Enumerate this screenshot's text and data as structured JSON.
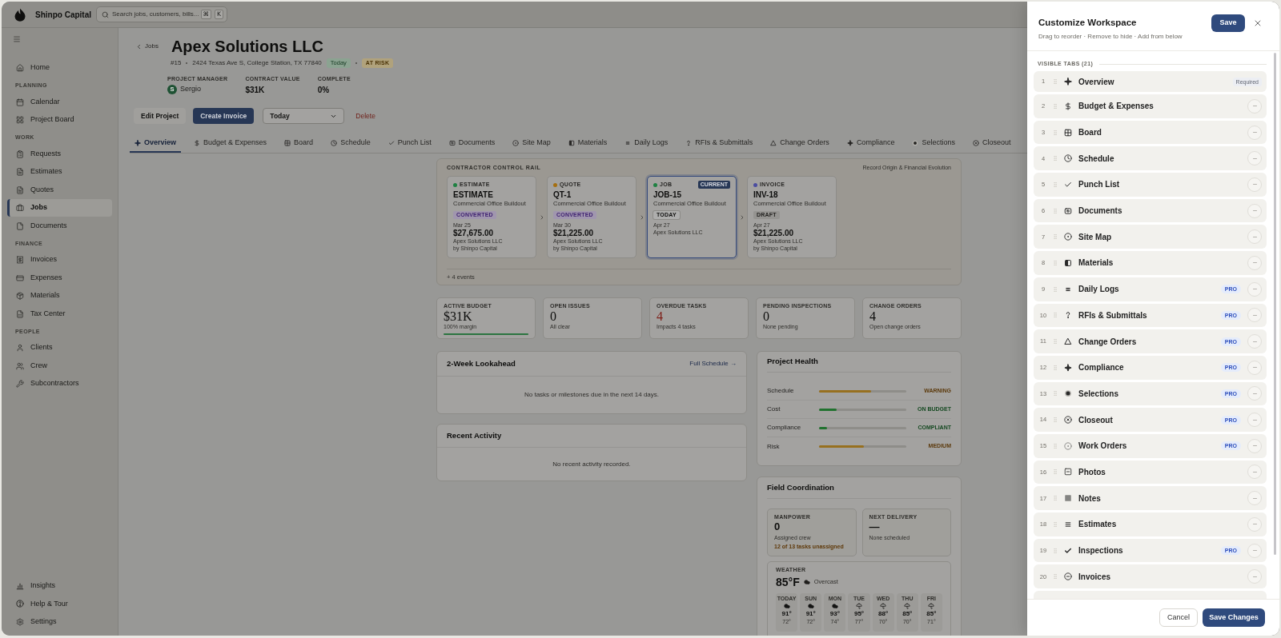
{
  "app": {
    "name": "Shinpo Capital",
    "search": {
      "placeholder": "Search jobs, customers, bills..."
    },
    "shortcut": [
      "⌘",
      "K"
    ]
  },
  "sidebar": {
    "sections": [
      {
        "items": [
          {
            "label": "Home",
            "selected": false
          }
        ]
      },
      {
        "label": "PLANNING",
        "items": [
          {
            "label": "Calendar",
            "selected": false
          },
          {
            "label": "Project Board",
            "selected": false
          }
        ]
      },
      {
        "label": "WORK",
        "items": [
          {
            "label": "Requests",
            "selected": false
          },
          {
            "label": "Estimates",
            "selected": false
          },
          {
            "label": "Quotes",
            "selected": false
          },
          {
            "label": "Jobs",
            "selected": true
          },
          {
            "label": "Documents",
            "selected": false
          }
        ]
      },
      {
        "label": "FINANCE",
        "items": [
          {
            "label": "Invoices",
            "selected": false
          },
          {
            "label": "Expenses",
            "selected": false
          },
          {
            "label": "Materials",
            "selected": false
          },
          {
            "label": "Tax Center",
            "selected": false
          }
        ]
      },
      {
        "label": "PEOPLE",
        "items": [
          {
            "label": "Clients",
            "selected": false
          },
          {
            "label": "Crew",
            "selected": false
          },
          {
            "label": "Subcontractors",
            "selected": false
          }
        ]
      }
    ],
    "footer_items": [
      {
        "label": "Insights",
        "selected": false
      },
      {
        "label": "Help & Tour",
        "selected": false
      },
      {
        "label": "Settings",
        "selected": false
      }
    ]
  },
  "job": {
    "back": "Jobs",
    "title": "Apex Solutions LLC",
    "number": "#15",
    "address": "2424 Texas Ave S, College Station, TX 77840",
    "badges": [
      {
        "text": "Today",
        "kind": "success"
      },
      {
        "text": "AT RISK",
        "kind": "warning"
      }
    ],
    "meta": [
      {
        "label": "PROJECT MANAGER",
        "value": "Sergio",
        "avatar": "S"
      },
      {
        "label": "CONTRACT VALUE",
        "value": "$31K"
      },
      {
        "label": "COMPLETE",
        "value": "0%"
      }
    ]
  },
  "actions": {
    "buttons": [
      {
        "label": "Edit Project",
        "kind": "secondary"
      },
      {
        "label": "Create Invoice",
        "kind": "primary"
      }
    ],
    "date_select": {
      "value": "Today"
    },
    "delete": "Delete"
  },
  "tabs": [
    {
      "label": "Overview",
      "selected": true
    },
    {
      "label": "Budget & Expenses",
      "selected": false
    },
    {
      "label": "Board",
      "selected": false
    },
    {
      "label": "Schedule",
      "selected": false
    },
    {
      "label": "Punch List",
      "selected": false
    },
    {
      "label": "Documents",
      "selected": false
    },
    {
      "label": "Site Map",
      "selected": false
    },
    {
      "label": "Materials",
      "selected": false
    },
    {
      "label": "Daily Logs",
      "selected": false
    },
    {
      "label": "RFIs & Submittals",
      "selected": false
    },
    {
      "label": "Change Orders",
      "selected": false
    },
    {
      "label": "Compliance",
      "selected": false
    },
    {
      "label": "Selections",
      "selected": false
    },
    {
      "label": "Closeout",
      "selected": false
    }
  ],
  "control_rail": {
    "title": "CONTRACTOR CONTROL RAIL",
    "subtitle": "Record Origin & Financial Evolution",
    "cards": [
      {
        "type": "ESTIMATE",
        "color": "#1f8142",
        "number": "ESTIMATE",
        "project": "Commercial Office Buildout",
        "status": {
          "text": "CONVERTED",
          "kind": "converted"
        },
        "current": false,
        "date": "Mar 25",
        "amount": "$27,675.00",
        "client": "Apex Solutions LLC",
        "by": "by Shinpo Capital"
      },
      {
        "type": "QUOTE",
        "color": "#a56f10",
        "number": "QT-1",
        "project": "Commercial Office Buildout",
        "status": {
          "text": "CONVERTED",
          "kind": "converted"
        },
        "current": false,
        "date": "Mar 30",
        "amount": "$21,225.00",
        "client": "Apex Solutions LLC",
        "by": "by Shinpo Capital"
      },
      {
        "type": "JOB",
        "color": "#1f8142",
        "number": "JOB-15",
        "project": "Commercial Office Buildout",
        "status": {
          "text": "TODAY",
          "kind": "today"
        },
        "current": true,
        "current_label": "CURRENT",
        "date": "Apr 27",
        "client": "Apex Solutions LLC"
      },
      {
        "type": "INVOICE",
        "color": "#4b4da0",
        "number": "INV-18",
        "project": "Commercial Office Buildout",
        "status": {
          "text": "DRAFT",
          "kind": "draft"
        },
        "current": false,
        "date": "Apr 27",
        "amount": "$21,225.00",
        "client": "Apex Solutions LLC",
        "by": "by Shinpo Capital"
      }
    ],
    "events": "+ 4 events"
  },
  "stats": [
    {
      "label": "ACTIVE BUDGET",
      "value": "$31K",
      "note": "100% margin",
      "alert": false,
      "level": 1
    },
    {
      "label": "OPEN ISSUES",
      "value": "0",
      "note": "All clear",
      "alert": false
    },
    {
      "label": "OVERDUE TASKS",
      "value": "4",
      "note": "Impacts 4 tasks",
      "alert": true
    },
    {
      "label": "PENDING INSPECTIONS",
      "value": "0",
      "note": "None pending",
      "alert": false
    },
    {
      "label": "CHANGE ORDERS",
      "value": "4",
      "note": "Open change orders",
      "alert": false
    }
  ],
  "lookahead": {
    "title": "2-Week Lookahead",
    "link": "Full Schedule →",
    "empty": "No tasks or milestones due in the next 14 days."
  },
  "recent_activity": {
    "title": "Recent Activity",
    "empty": "No recent activity recorded."
  },
  "project_health": {
    "title": "Project Health",
    "rows": [
      {
        "label": "Schedule",
        "level": 0.6,
        "status": "WARNING",
        "kind": "warning"
      },
      {
        "label": "Cost",
        "level": 0.2,
        "status": "ON BUDGET",
        "kind": "good"
      },
      {
        "label": "Compliance",
        "level": 0.09,
        "status": "COMPLIANT",
        "kind": "good"
      },
      {
        "label": "Risk",
        "level": 0.51,
        "status": "MEDIUM",
        "kind": "warning"
      }
    ]
  },
  "field_coordination": {
    "title": "Field Coordination",
    "tiles": [
      {
        "label": "MANPOWER",
        "value": "0",
        "note": "Assigned crew",
        "alert": "12 of 13 tasks unassigned"
      },
      {
        "label": "NEXT DELIVERY",
        "value": "—",
        "note": "None scheduled"
      }
    ],
    "weather": {
      "label": "WEATHER",
      "temp": "85°F",
      "condition": "Overcast",
      "days": [
        {
          "day": "TODAY",
          "kind": "cloudy",
          "high": "91°",
          "low": "72°"
        },
        {
          "day": "SUN",
          "kind": "cloudy",
          "high": "91°",
          "low": "72°"
        },
        {
          "day": "MON",
          "kind": "cloudy",
          "high": "93°",
          "low": "74°"
        },
        {
          "day": "TUE",
          "kind": "rain",
          "high": "95°",
          "low": "77°"
        },
        {
          "day": "WED",
          "kind": "rain",
          "high": "88°",
          "low": "70°"
        },
        {
          "day": "THU",
          "kind": "rain",
          "high": "85°",
          "low": "70°"
        },
        {
          "day": "FRI",
          "kind": "rain",
          "high": "85°",
          "low": "71°"
        }
      ]
    }
  },
  "panel": {
    "title": "Customize Workspace",
    "subtitle": "Drag to reorder · Remove to hide · Add from below",
    "save": "Save",
    "section": "VISIBLE TABS (21)",
    "rows": [
      {
        "number": "1",
        "label": "Overview",
        "badge": {
          "kind": "required",
          "text": "Required"
        },
        "removable": false
      },
      {
        "number": "2",
        "label": "Budget & Expenses",
        "removable": true
      },
      {
        "number": "3",
        "label": "Board",
        "removable": true
      },
      {
        "number": "4",
        "label": "Schedule",
        "removable": true
      },
      {
        "number": "5",
        "label": "Punch List",
        "removable": true
      },
      {
        "number": "6",
        "label": "Documents",
        "removable": true
      },
      {
        "number": "7",
        "label": "Site Map",
        "removable": true
      },
      {
        "number": "8",
        "label": "Materials",
        "removable": true
      },
      {
        "number": "9",
        "label": "Daily Logs",
        "badge": {
          "kind": "pro",
          "text": "PRO"
        },
        "removable": true
      },
      {
        "number": "10",
        "label": "RFIs & Submittals",
        "badge": {
          "kind": "pro",
          "text": "PRO"
        },
        "removable": true
      },
      {
        "number": "11",
        "label": "Change Orders",
        "badge": {
          "kind": "pro",
          "text": "PRO"
        },
        "removable": true
      },
      {
        "number": "12",
        "label": "Compliance",
        "badge": {
          "kind": "pro",
          "text": "PRO"
        },
        "removable": true
      },
      {
        "number": "13",
        "label": "Selections",
        "badge": {
          "kind": "pro",
          "text": "PRO"
        },
        "removable": true
      },
      {
        "number": "14",
        "label": "Closeout",
        "badge": {
          "kind": "pro",
          "text": "PRO"
        },
        "removable": true
      },
      {
        "number": "15",
        "label": "Work Orders",
        "badge": {
          "kind": "pro",
          "text": "PRO"
        },
        "removable": true
      },
      {
        "number": "16",
        "label": "Photos",
        "removable": true
      },
      {
        "number": "17",
        "label": "Notes",
        "removable": true
      },
      {
        "number": "18",
        "label": "Estimates",
        "removable": true
      },
      {
        "number": "19",
        "label": "Inspections",
        "badge": {
          "kind": "pro",
          "text": "PRO"
        },
        "removable": true
      },
      {
        "number": "20",
        "label": "Invoices",
        "removable": true
      }
    ],
    "cancel": "Cancel",
    "save_changes": "Save Changes"
  }
}
